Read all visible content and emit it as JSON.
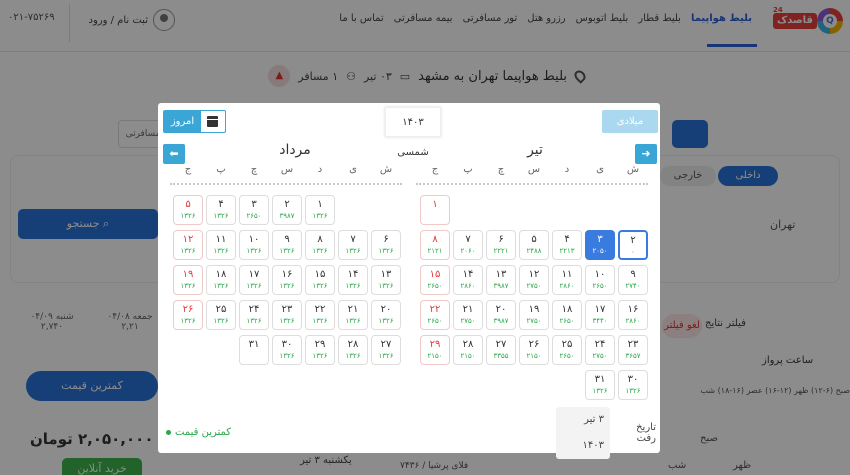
{
  "header": {
    "logo_text": "قاصدک",
    "logo_badge": "24",
    "nav": [
      "بلیط هواپیما",
      "بلیط قطار",
      "بلیط اتوبوس",
      "رزرو هتل",
      "تور مسافرتی",
      "بیمه مسافرتی",
      "تماس با ما"
    ],
    "login": "ثبت نام / ورود",
    "phone": "۰۲۱-۷۵۲۶۹"
  },
  "summary": {
    "title": "بلیط هواپیما تهران به مشهد",
    "date": "۰۳ تیر",
    "passengers": "۱ مسافر"
  },
  "background": {
    "tab_domestic": "داخلی",
    "tab_foreign": "خارجی",
    "origin": "تهران",
    "search": "جستجو",
    "passengers_field": "مسافرتی",
    "filter": "فیلتر نتایج",
    "cancel": "لغو فیلتر",
    "flight_time": "ساعت پرواز",
    "flight_time_opts": "صبح (۶-۱۲) ظهر (۱۲-۱۶) عصر (۱۶-۱۸) شب",
    "lowest_price": "کمترین قیمت",
    "price": "۲,۰۵۰,۰۰۰ تومان",
    "buy": "خرید آنلاین",
    "flight_date": "یکشنبه ۳ تیر",
    "airline": "فلای پرشیا / ۷۴۳۶",
    "dial_morning": "صبح",
    "dial_noon": "ظهر",
    "dial_night": "شب",
    "side_dates": [
      {
        "label": "شنبه ۰۴/۰۹",
        "price": "۲,۷۴۰"
      },
      {
        "label": "جمعه ۰۴/۰۸",
        "price": "۲,۲۱"
      }
    ]
  },
  "calendar": {
    "gregorian_button": "میلادی",
    "year_label": "۱۴۰۳ شمسی",
    "today_button": "امروز",
    "weekdays": [
      "ش",
      "ی",
      "د",
      "س",
      "چ",
      "پ",
      "ج"
    ],
    "months": [
      {
        "name": "تیر",
        "days": [
          {
            "day": "۱",
            "price": "",
            "fri": true,
            "col": 6,
            "row": 0
          },
          {
            "day": "۲",
            "price": "۰",
            "today": true,
            "col": 0,
            "row": 1
          },
          {
            "day": "۳",
            "price": "۲۰۵۰",
            "selected": true,
            "col": 1,
            "row": 1
          },
          {
            "day": "۴",
            "price": "۲۲۱۳",
            "col": 2,
            "row": 1
          },
          {
            "day": "۵",
            "price": "۲۴۸۸",
            "col": 3,
            "row": 1
          },
          {
            "day": "۶",
            "price": "۲۲۲۱",
            "col": 4,
            "row": 1
          },
          {
            "day": "۷",
            "price": "۲۰۶۰",
            "col": 5,
            "row": 1
          },
          {
            "day": "۸",
            "price": "۲۱۲۱",
            "fri": true,
            "col": 6,
            "row": 1
          },
          {
            "day": "۹",
            "price": "۲۷۴۰",
            "col": 0,
            "row": 2
          },
          {
            "day": "۱۰",
            "price": "۲۶۵۰",
            "col": 1,
            "row": 2
          },
          {
            "day": "۱۱",
            "price": "۲۸۶۰",
            "col": 2,
            "row": 2
          },
          {
            "day": "۱۲",
            "price": "۲۷۵۰",
            "col": 3,
            "row": 2
          },
          {
            "day": "۱۳",
            "price": "۳۹۸۷",
            "col": 4,
            "row": 2
          },
          {
            "day": "۱۴",
            "price": "۲۸۶۰",
            "col": 5,
            "row": 2
          },
          {
            "day": "۱۵",
            "price": "۲۶۵۰",
            "fri": true,
            "col": 6,
            "row": 2
          },
          {
            "day": "۱۶",
            "price": "۲۸۶۰",
            "col": 0,
            "row": 3
          },
          {
            "day": "۱۷",
            "price": "۳۴۴۰",
            "col": 1,
            "row": 3
          },
          {
            "day": "۱۸",
            "price": "۲۶۵۰",
            "col": 2,
            "row": 3
          },
          {
            "day": "۱۹",
            "price": "۲۷۵۰",
            "col": 3,
            "row": 3
          },
          {
            "day": "۲۰",
            "price": "۳۹۸۷",
            "col": 4,
            "row": 3
          },
          {
            "day": "۲۱",
            "price": "۲۷۵۰",
            "col": 5,
            "row": 3
          },
          {
            "day": "۲۲",
            "price": "۲۶۵۰",
            "fri": true,
            "col": 6,
            "row": 3
          },
          {
            "day": "۲۳",
            "price": "۳۶۵۷",
            "col": 0,
            "row": 4
          },
          {
            "day": "۲۴",
            "price": "۲۷۵۰",
            "col": 1,
            "row": 4
          },
          {
            "day": "۲۵",
            "price": "۲۶۵۰",
            "col": 2,
            "row": 4
          },
          {
            "day": "۲۶",
            "price": "۲۱۵۰",
            "col": 3,
            "row": 4
          },
          {
            "day": "۲۷",
            "price": "۳۳۵۵",
            "col": 4,
            "row": 4
          },
          {
            "day": "۲۸",
            "price": "۲۱۵۰",
            "col": 5,
            "row": 4
          },
          {
            "day": "۲۹",
            "price": "۲۱۵۰",
            "fri": true,
            "col": 6,
            "row": 4
          },
          {
            "day": "۳۰",
            "price": "۱۳۲۶",
            "col": 0,
            "row": 5
          },
          {
            "day": "۳۱",
            "price": "۱۳۲۶",
            "col": 1,
            "row": 5
          }
        ]
      },
      {
        "name": "مرداد",
        "days": [
          {
            "day": "۱",
            "price": "۱۳۲۶",
            "col": 3,
            "row": 0
          },
          {
            "day": "۲",
            "price": "۳۹۸۷",
            "col": 4,
            "row": 0
          },
          {
            "day": "۳",
            "price": "۲۶۵۰",
            "col": 5,
            "row": 0
          },
          {
            "day": "۴",
            "price": "۱۳۲۶",
            "col": 6,
            "row": 0,
            "x": 1
          },
          {
            "day": "۵",
            "price": "۱۳۲۶",
            "fri": true,
            "col": 7,
            "row": 0
          },
          {
            "day": "۶",
            "price": "۱۳۲۶",
            "col": 0,
            "row": 1
          },
          {
            "day": "۷",
            "price": "۱۳۲۶",
            "col": 1,
            "row": 1
          },
          {
            "day": "۸",
            "price": "۱۳۲۶",
            "col": 2,
            "row": 1
          },
          {
            "day": "۹",
            "price": "۱۳۲۶",
            "col": 3,
            "row": 1
          },
          {
            "day": "۱۰",
            "price": "۱۳۲۶",
            "col": 4,
            "row": 1
          },
          {
            "day": "۱۱",
            "price": "۱۳۲۶",
            "col": 5,
            "row": 1
          },
          {
            "day": "۱۲",
            "price": "۱۳۲۶",
            "fri": true,
            "col": 6,
            "row": 1
          },
          {
            "day": "۱۳",
            "price": "۱۳۲۶",
            "col": 0,
            "row": 2
          },
          {
            "day": "۱۴",
            "price": "۱۳۲۶",
            "col": 1,
            "row": 2
          },
          {
            "day": "۱۵",
            "price": "۱۳۲۶",
            "col": 2,
            "row": 2
          },
          {
            "day": "۱۶",
            "price": "۱۳۲۶",
            "col": 3,
            "row": 2
          },
          {
            "day": "۱۷",
            "price": "۱۳۲۶",
            "col": 4,
            "row": 2
          },
          {
            "day": "۱۸",
            "price": "۱۳۲۶",
            "col": 5,
            "row": 2
          },
          {
            "day": "۱۹",
            "price": "۱۳۲۶",
            "fri": true,
            "col": 6,
            "row": 2
          },
          {
            "day": "۲۰",
            "price": "۱۳۲۶",
            "col": 0,
            "row": 3
          },
          {
            "day": "۲۱",
            "price": "۱۳۲۶",
            "col": 1,
            "row": 3
          },
          {
            "day": "۲۲",
            "price": "۱۳۲۶",
            "col": 2,
            "row": 3
          },
          {
            "day": "۲۳",
            "price": "۱۳۲۶",
            "col": 3,
            "row": 3
          },
          {
            "day": "۲۴",
            "price": "۱۳۲۶",
            "col": 4,
            "row": 3
          },
          {
            "day": "۲۵",
            "price": "۱۳۲۶",
            "col": 5,
            "row": 3
          },
          {
            "day": "۲۶",
            "price": "۱۳۲۶",
            "fri": true,
            "col": 6,
            "row": 3
          },
          {
            "day": "۲۷",
            "price": "۱۳۲۶",
            "col": 0,
            "row": 4
          },
          {
            "day": "۲۸",
            "price": "۱۳۲۶",
            "col": 1,
            "row": 4
          },
          {
            "day": "۲۹",
            "price": "۱۳۲۶",
            "col": 2,
            "row": 4
          },
          {
            "day": "۳۰",
            "price": "۱۳۲۶",
            "col": 3,
            "row": 4
          },
          {
            "day": "۳۱",
            "price": "",
            "col": 4,
            "row": 4
          }
        ]
      }
    ],
    "footer_label": "تاریخ رفت",
    "footer_value": "۳ تیر ۱۴۰۳",
    "legend": "کمترین قیمت"
  }
}
